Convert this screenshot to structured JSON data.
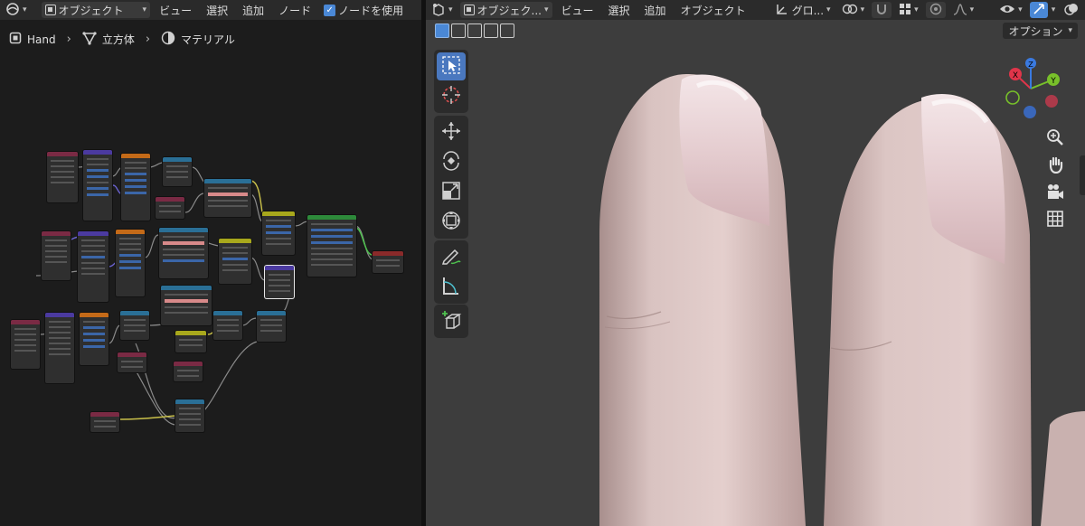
{
  "node_editor": {
    "header": {
      "editor_type_icon": "node-editor-icon",
      "object_mode_label": "オブジェクト",
      "menu_view": "ビュー",
      "menu_select": "選択",
      "menu_add": "追加",
      "menu_node": "ノード",
      "use_nodes_label": "ノードを使用",
      "use_nodes_checked": true
    },
    "breadcrumbs": [
      {
        "label": "Hand",
        "icon": "object-icon"
      },
      {
        "label": "立方体",
        "icon": "mesh-icon"
      },
      {
        "label": "マテリアル",
        "icon": "material-icon"
      }
    ],
    "colors": {
      "input_header": "#7a2a44",
      "vector_header": "#4b3aa0",
      "texture_header": "#c46a18",
      "converter_header": "#2a6f96",
      "color_header": "#a8a81c",
      "shader_header": "#2d8a3a",
      "output_header": "#8a2a2a"
    }
  },
  "viewport": {
    "header": {
      "object_mode_label": "オブジェク...",
      "menu_view": "ビュー",
      "menu_select": "選択",
      "menu_add": "追加",
      "menu_object": "オブジェクト",
      "transform_orientation": "グロ..."
    },
    "options_label": "オプション",
    "gizmo": {
      "x_label": "X",
      "y_label": "Y",
      "z_label": "Z",
      "x_color": "#e0354a",
      "y_color": "#78c02a",
      "z_color": "#3a7ae0"
    },
    "accent": "#4a88d6",
    "skin_color": "#d9bfbd"
  }
}
